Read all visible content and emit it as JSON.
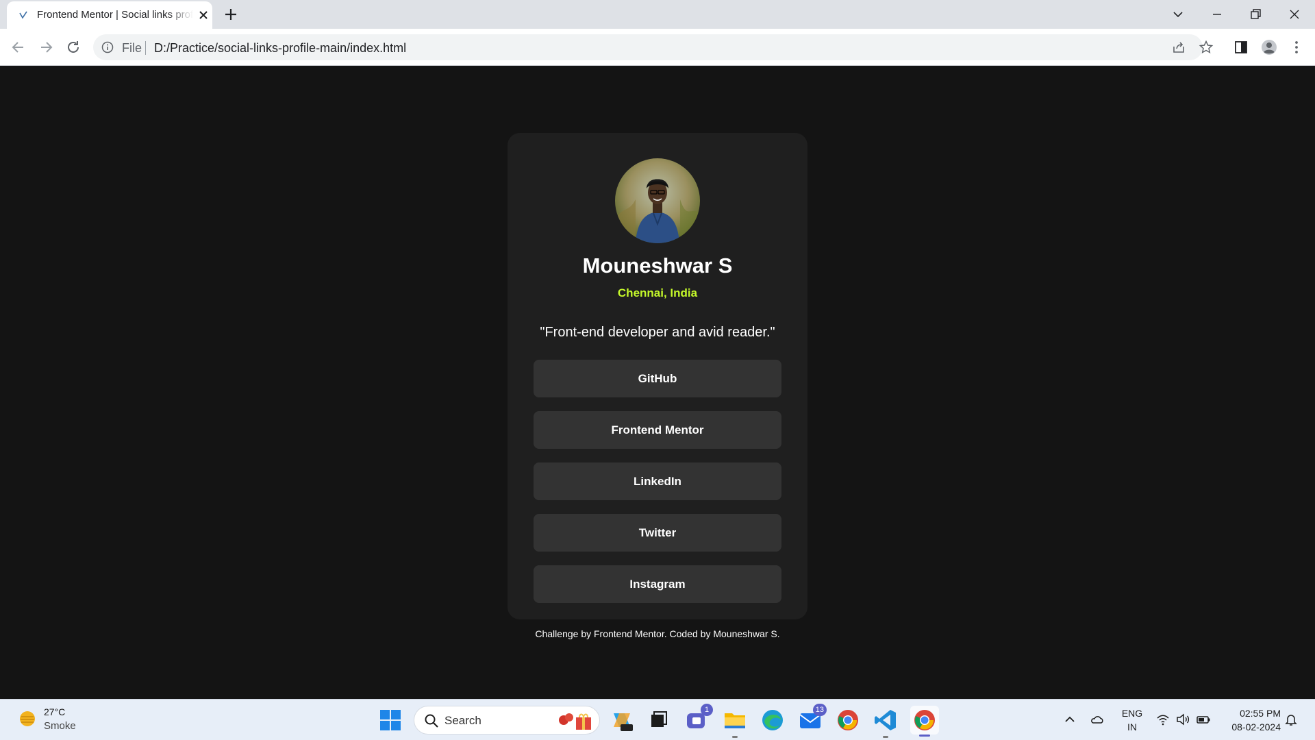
{
  "browser": {
    "tab_title": "Frontend Mentor | Social links profile",
    "url_scheme": "File",
    "url": "D:/Practice/social-links-profile-main/index.html"
  },
  "profile": {
    "name": "Mouneshwar S",
    "location": "Chennai, India",
    "bio": "\"Front-end developer and avid reader.\"",
    "links": [
      {
        "label": "GitHub"
      },
      {
        "label": "Frontend Mentor"
      },
      {
        "label": "LinkedIn"
      },
      {
        "label": "Twitter"
      },
      {
        "label": "Instagram"
      }
    ]
  },
  "attribution": {
    "prefix": "Challenge by ",
    "challenge_link": "Frontend Mentor",
    "middle": ". Coded by ",
    "author_link": "Mouneshwar S",
    "suffix": "."
  },
  "taskbar": {
    "weather_temp": "27°C",
    "weather_condition": "Smoke",
    "search_placeholder": "Search",
    "teams_badge": "1",
    "mail_badge": "13",
    "lang_line1": "ENG",
    "lang_line2": "IN",
    "time": "02:55 PM",
    "date": "08-02-2024"
  },
  "colors": {
    "page_bg": "#141414",
    "card_bg": "#1f1f1f",
    "button_bg": "#333333",
    "accent": "#c4f82a"
  },
  "icons": {
    "browser": [
      "favicon",
      "close-icon",
      "plus-icon",
      "chevron-down-icon",
      "minimize-icon",
      "restore-icon",
      "close-window-icon",
      "back-arrow-icon",
      "forward-arrow-icon",
      "reload-icon",
      "info-icon",
      "share-icon",
      "star-icon",
      "side-panel-icon",
      "profile-icon",
      "menu-dots-icon"
    ],
    "taskbar": [
      "weather-icon",
      "windows-start-icon",
      "search-icon",
      "copilot-icon",
      "task-view-icon",
      "teams-icon",
      "file-explorer-icon",
      "edge-icon",
      "mail-icon",
      "chrome-icon",
      "vscode-icon",
      "chevron-up-icon",
      "onedrive-icon",
      "wifi-icon",
      "volume-icon",
      "battery-icon",
      "bell-icon"
    ]
  }
}
